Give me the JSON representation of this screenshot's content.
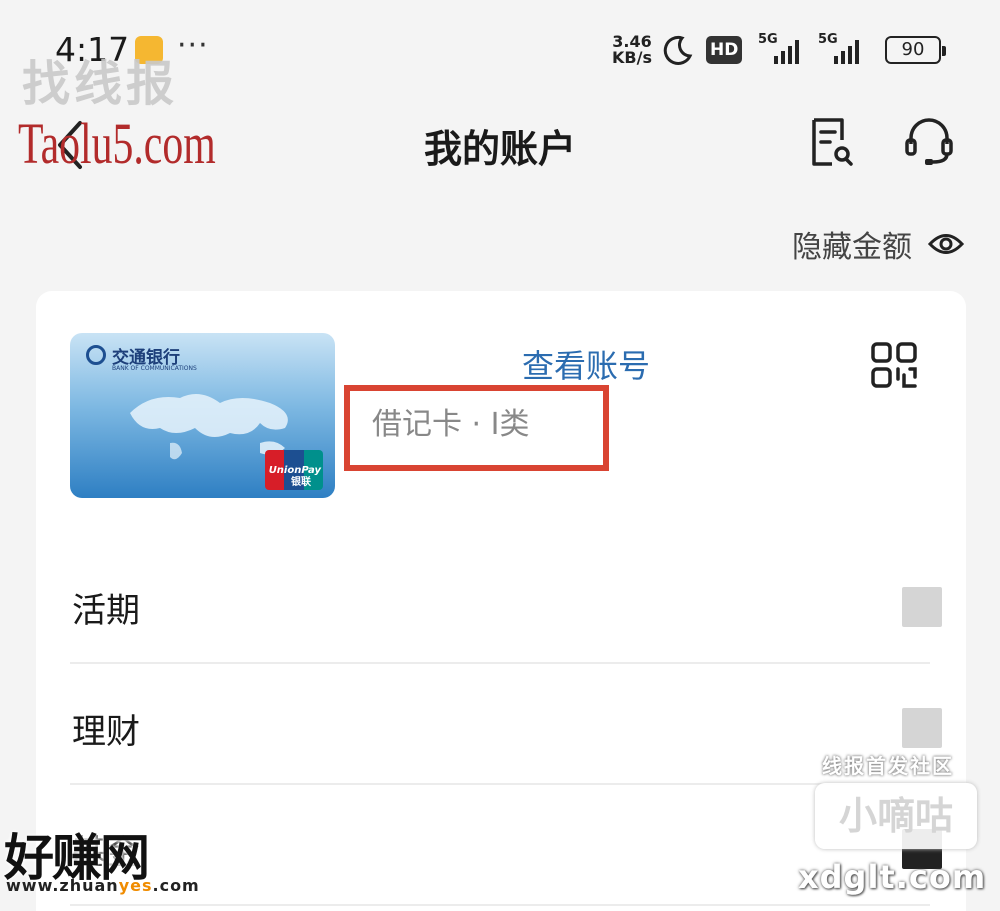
{
  "status_bar": {
    "time": "4:17",
    "more": "···",
    "net_speed_value": "3.46",
    "net_speed_unit": "KB/s",
    "hd_label": "HD",
    "signal1_label": "5G",
    "signal2_label": "5G",
    "battery": "90"
  },
  "header": {
    "title": "我的账户",
    "back_icon": "chevron-left-icon",
    "bill_icon": "document-search-icon",
    "service_icon": "headset-icon"
  },
  "hide_amounts": {
    "label": "隐藏金额",
    "icon": "eye-icon"
  },
  "account": {
    "card_bank_name": "交通银行",
    "card_bank_sub": "BANK OF COMMUNICATIONS",
    "card_unionpay": "UnionPay",
    "card_unionpay_cn": "银联",
    "view_account_label": "查看账号",
    "card_type": "借记卡 · Ⅰ类",
    "qr_icon": "qr-code-icon"
  },
  "rows": [
    {
      "label": "活期"
    },
    {
      "label": "理财"
    },
    {
      "label": "基金"
    }
  ],
  "watermarks": {
    "top_left_cn": "找线报",
    "top_left_en": "Taolu5.com",
    "bottom_right_cn_top": "线报首发社区",
    "bottom_right_cn": "小嘀咕",
    "bottom_right_en": "xdglt.com",
    "bottom_left_cn": "好赚网",
    "bottom_left_url_a": "www.zhuan",
    "bottom_left_url_b": "yes",
    "bottom_left_url_c": ".com"
  },
  "colors": {
    "link_blue": "#2b6cb0",
    "highlight_red": "#d94432",
    "background": "#f4f4f4"
  }
}
